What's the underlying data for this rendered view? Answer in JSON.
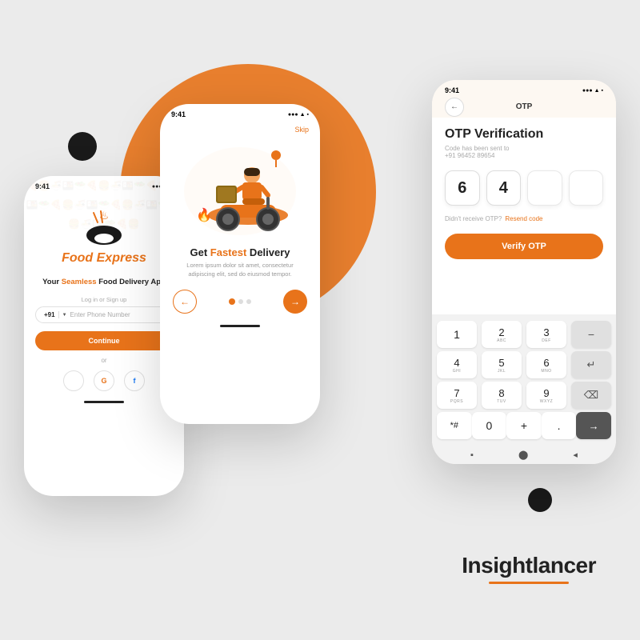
{
  "background": {
    "color": "#ebebeb"
  },
  "brand": {
    "name": "Insightlancer",
    "underline_color": "#E8731A"
  },
  "phone1": {
    "status_time": "9:41",
    "signal": "●●● ▲ ▪",
    "app_name": "Food Express",
    "tagline_prefix": "Your ",
    "tagline_highlight": "Seamless",
    "tagline_suffix": " Food Delivery App",
    "login_label": "Log in or Sign up",
    "country_code": "+91",
    "phone_placeholder": "Enter Phone Number",
    "continue_btn": "Continue",
    "or_text": "or",
    "social_apple": "",
    "social_google": "G",
    "social_facebook": "f"
  },
  "phone2": {
    "status_time": "9:41",
    "skip_label": "Skip",
    "slide_title_prefix": "Get ",
    "slide_title_highlight": "Fastest",
    "slide_title_suffix": " Delivery",
    "slide_desc": "Lorem ipsum dolor sit amet, consectetur adipiscing elit, sed do eiusmod tempor.",
    "dots": [
      "active",
      "inactive",
      "inactive"
    ],
    "prev_icon": "←",
    "next_icon": "→"
  },
  "phone3": {
    "status_time": "9:41",
    "header_title": "OTP",
    "back_icon": "←",
    "title": "OTP Verification",
    "subtitle_line1": "Code has been sent to",
    "subtitle_line2": "+91 96452 89654",
    "otp_digits": [
      "6",
      "4",
      "",
      ""
    ],
    "didnt_receive": "Didn't receive OTP?",
    "resend_label": "Resend code",
    "verify_btn": "Verify OTP",
    "keypad": {
      "rows": [
        [
          {
            "main": "1",
            "sub": ""
          },
          {
            "main": "2",
            "sub": "ABC"
          },
          {
            "main": "3",
            "sub": "DEF"
          },
          {
            "main": "−",
            "sub": "",
            "type": "action"
          }
        ],
        [
          {
            "main": "4",
            "sub": "GHI"
          },
          {
            "main": "5",
            "sub": "JKL"
          },
          {
            "main": "6",
            "sub": "MNO"
          },
          {
            "main": "↵",
            "sub": "",
            "type": "action"
          }
        ],
        [
          {
            "main": "7",
            "sub": "PQRS"
          },
          {
            "main": "8",
            "sub": "TUV"
          },
          {
            "main": "9",
            "sub": "WXYZ"
          },
          {
            "main": "⌫",
            "sub": "",
            "type": "action"
          }
        ],
        [
          {
            "main": "*#",
            "sub": ""
          },
          {
            "main": "0",
            "sub": ""
          },
          {
            "main": "+",
            "sub": ""
          },
          {
            "main": ".",
            "sub": ""
          },
          {
            "main": "→|",
            "sub": "",
            "type": "dark"
          }
        ]
      ],
      "bottom_nav": [
        "▪",
        "⬤",
        "◂"
      ]
    }
  }
}
